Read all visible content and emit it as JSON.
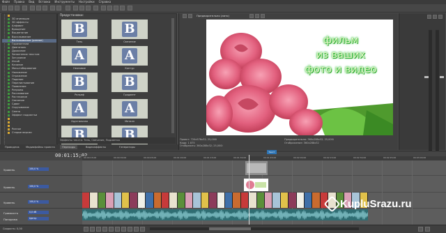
{
  "menu": [
    "Файл",
    "Правка",
    "Вид",
    "Вставка",
    "Инструменты",
    "Настройки",
    "Справка"
  ],
  "tree": {
    "items": [
      {
        "label": "",
        "type": "folder"
      },
      {
        "label": "3D анимация",
        "type": "item"
      },
      {
        "label": "3D эффекты",
        "type": "item"
      },
      {
        "label": "Алфавит",
        "type": "item"
      },
      {
        "label": "Вращение",
        "type": "item"
      },
      {
        "label": "Выцветание",
        "type": "item"
      },
      {
        "label": "Выскакивание",
        "type": "item"
      },
      {
        "label": "Выталкивание (разное)",
        "type": "item",
        "selected": true
      },
      {
        "label": "Горизонтали",
        "type": "item"
      },
      {
        "label": "Диагональ",
        "type": "item"
      },
      {
        "label": "Дрожание",
        "type": "item"
      },
      {
        "label": "Заполнение текстом",
        "type": "item"
      },
      {
        "label": "Затухание",
        "type": "item"
      },
      {
        "label": "Изгиб",
        "type": "item"
      },
      {
        "label": "Качание",
        "type": "item"
      },
      {
        "label": "Масштабирование",
        "type": "item"
      },
      {
        "label": "Наложение",
        "type": "item"
      },
      {
        "label": "Отражение",
        "type": "item"
      },
      {
        "label": "Падение",
        "type": "item"
      },
      {
        "label": "Перелистывание",
        "type": "item"
      },
      {
        "label": "Появление",
        "type": "item"
      },
      {
        "label": "Разрывы",
        "type": "item"
      },
      {
        "label": "Рассеивание",
        "type": "item"
      },
      {
        "label": "Растекание",
        "type": "item"
      },
      {
        "label": "Свечение",
        "type": "item"
      },
      {
        "label": "Сдвиг",
        "type": "item"
      },
      {
        "label": "Скручивание",
        "type": "item"
      },
      {
        "label": "Смена",
        "type": "item"
      },
      {
        "label": "Эффект подсветки",
        "type": "item"
      },
      {
        "label": "",
        "type": "folder"
      },
      {
        "label": "",
        "type": "folder"
      },
      {
        "label": "",
        "type": "folder"
      },
      {
        "label": "Разное",
        "type": "folder"
      },
      {
        "label": "Старые версии",
        "type": "folder"
      }
    ]
  },
  "presets": {
    "title": "Предустановки:",
    "items": [
      {
        "label": "Тень",
        "glyph": "B"
      },
      {
        "label": "Свечение",
        "glyph": "B"
      },
      {
        "label": "Неоновое",
        "glyph": "A"
      },
      {
        "label": "Контур",
        "glyph": "A"
      },
      {
        "label": "Рельеф",
        "glyph": "B"
      },
      {
        "label": "Градиент",
        "glyph": "B"
      },
      {
        "label": "Хрустальная",
        "glyph": "A"
      },
      {
        "label": "Металл",
        "glyph": "A"
      },
      {
        "label": "Объем",
        "glyph": "B"
      },
      {
        "label": "Пиксели",
        "glyph": "B"
      }
    ],
    "description": "Эффекты текста: Тень, Свечение, Подсветка"
  },
  "tabs": [
    "Проводник",
    "Медиафайлы проекта",
    "Переходы",
    "Видеоэффекты",
    "Генераторы"
  ],
  "preview": {
    "mode": "Предварительно (авто)",
    "overlay_lines": [
      "фильм",
      "из ваших",
      "фото и видео"
    ],
    "info_left": [
      "Проект: 720x576x32; 25,000i",
      "Кадр: 1 875",
      "Отобразить: 360x288x32; 25,000i"
    ],
    "info_right": [
      "Предварительно: 360x288x32; 25,000i",
      "Отображение: 360x288x32"
    ]
  },
  "timeline": {
    "timecode": "00:01:15;02",
    "ruler": [
      "00:00:15;00",
      "00:00:30;00",
      "00:00:45;00",
      "00:01:00;00",
      "00:01:15;00",
      "00:01:30;00",
      "00:01:45;00",
      "00:02:00;00",
      "00:02:15;00",
      "00:02:30;00",
      "00:02:45;00",
      "00:03:00;00"
    ],
    "tracks": [
      {
        "name": "Уровень",
        "value": "100,0 %"
      },
      {
        "name": "Уровень",
        "value": "100,0 %"
      },
      {
        "name": "Уровень",
        "value": "100,0 %"
      },
      {
        "name": "Громкость",
        "value": "0,0 dB"
      },
      {
        "name": "Панорама",
        "value": "Центр"
      }
    ],
    "marker_label": "Текст",
    "rate": "Скорость: 0,00"
  },
  "watermark": "KupluSrazu.ru",
  "colors": {
    "overlay_text": "#e8f3c9",
    "overlay_glow": "#2ec23a",
    "selection": "#5a6b86"
  }
}
